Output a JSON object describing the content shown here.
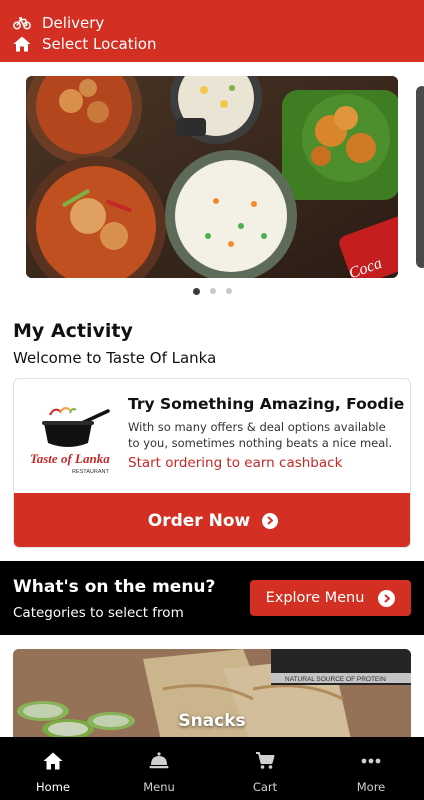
{
  "header": {
    "delivery_label": "Delivery",
    "location_label": "Select Location",
    "bg_color": "#d32f22"
  },
  "carousel": {
    "slide_count": 3,
    "active_index": 0,
    "brand_text": "Coca"
  },
  "activity": {
    "title": "My Activity",
    "subtitle": "Welcome to Taste Of Lanka"
  },
  "promo": {
    "logo_line1": "Taste of Lanka",
    "logo_line2": "RESTAURANT",
    "title": "Try Something Amazing, Foodie",
    "body": "With so many offers & deal options available to you, sometimes nothing beats a nice meal.",
    "cta": "Start ordering to earn cashback",
    "order_button": "Order Now"
  },
  "menu_band": {
    "title": "What's on the menu?",
    "subtitle": "Categories to select from",
    "explore_button": "Explore Menu"
  },
  "category": {
    "label": "Snacks",
    "package_text": "NATURAL SOURCE OF PROTEIN"
  },
  "bottom_nav": {
    "items": [
      {
        "label": "Home",
        "icon": "home-icon",
        "active": true
      },
      {
        "label": "Menu",
        "icon": "cloche-icon",
        "active": false
      },
      {
        "label": "Cart",
        "icon": "cart-icon",
        "active": false
      },
      {
        "label": "More",
        "icon": "more-dots-icon",
        "active": false
      }
    ]
  },
  "colors": {
    "accent": "#d32f22",
    "dark": "#000000",
    "cta_text": "#c62828"
  }
}
